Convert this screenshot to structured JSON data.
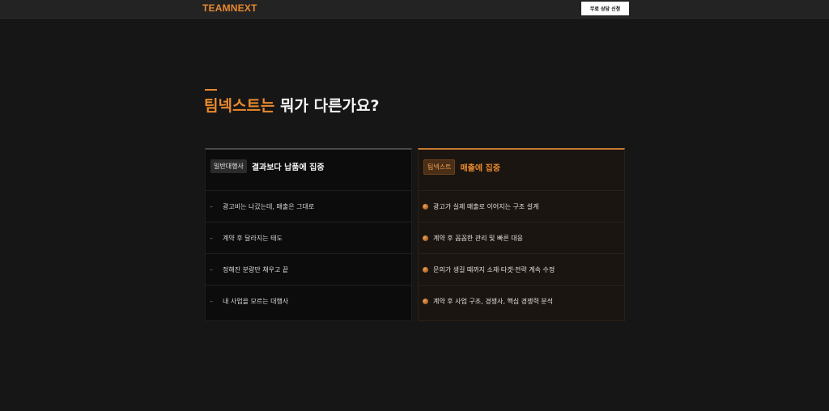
{
  "header": {
    "logo": "TEAMNEXT",
    "cta_label": "무료 상담 신청"
  },
  "section": {
    "title_highlight": "팀넥스트는",
    "title_rest": " 뭐가 다른가요?"
  },
  "cards": {
    "general": {
      "badge": "일반대행사",
      "title": "결과보다 납품에 집중",
      "items": [
        "광고비는 나갔는데, 매출은 그대로",
        "계약 후 달라지는 태도",
        "정해진 분량만 채우고 끝",
        "내 사업을 모르는 대행사"
      ]
    },
    "teamnext": {
      "badge": "팀넥스트",
      "title": "매출에 집중",
      "items": [
        "광고가 실제 매출로 이어지는 구조 설계",
        "계약 후 꼼꼼한 관리 및 빠른 대응",
        "문의가 생길 때까지 소재·타겟·전략 계속 수정",
        "계약 후 사업 구조, 경쟁사, 핵심 경쟁력 분석"
      ]
    }
  },
  "colors": {
    "accent": "#e8892e",
    "background": "#161616"
  }
}
